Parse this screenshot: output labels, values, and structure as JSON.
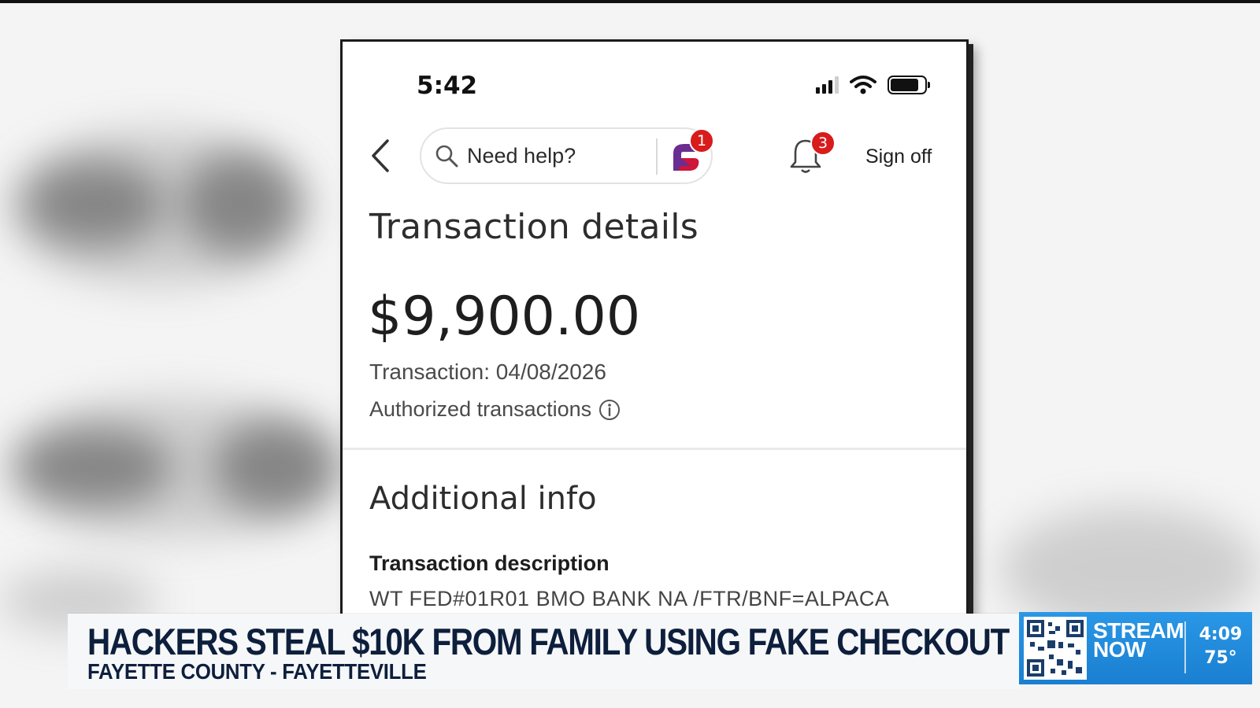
{
  "phone": {
    "status_time": "5:42",
    "header": {
      "search_label": "Need help?",
      "assistant_badge": "1",
      "notifications_badge": "3",
      "sign_off": "Sign off"
    },
    "title": "Transaction details",
    "amount": "$9,900.00",
    "transaction_date": "Transaction: 04/08/2026",
    "authorized_label": "Authorized transactions",
    "additional_info_title": "Additional info",
    "description_label": "Transaction description",
    "description_value": "WT FED#01R01 BMO BANK NA /FTR/BNF=ALPACA"
  },
  "lower_third": {
    "headline": "HACKERS STEAL $10K FROM FAMILY USING FAKE CHECKOUT",
    "location": "FAYETTE COUNTY - FAYETTEVILLE",
    "stream_line1": "STREAM",
    "stream_line2": "NOW",
    "time": "4:09",
    "temperature": "75°"
  },
  "colors": {
    "headline_navy": "#0d1f3c",
    "stream_blue": "#1f8ad9",
    "badge_red": "#d81b1b",
    "assistant_purple": "#6b2d8f",
    "assistant_red": "#d0153a"
  },
  "icons": [
    "back-chevron-icon",
    "search-icon",
    "assistant-logo-icon",
    "bell-icon",
    "info-icon",
    "signal-icon",
    "wifi-icon",
    "battery-icon",
    "qr-code-icon"
  ]
}
